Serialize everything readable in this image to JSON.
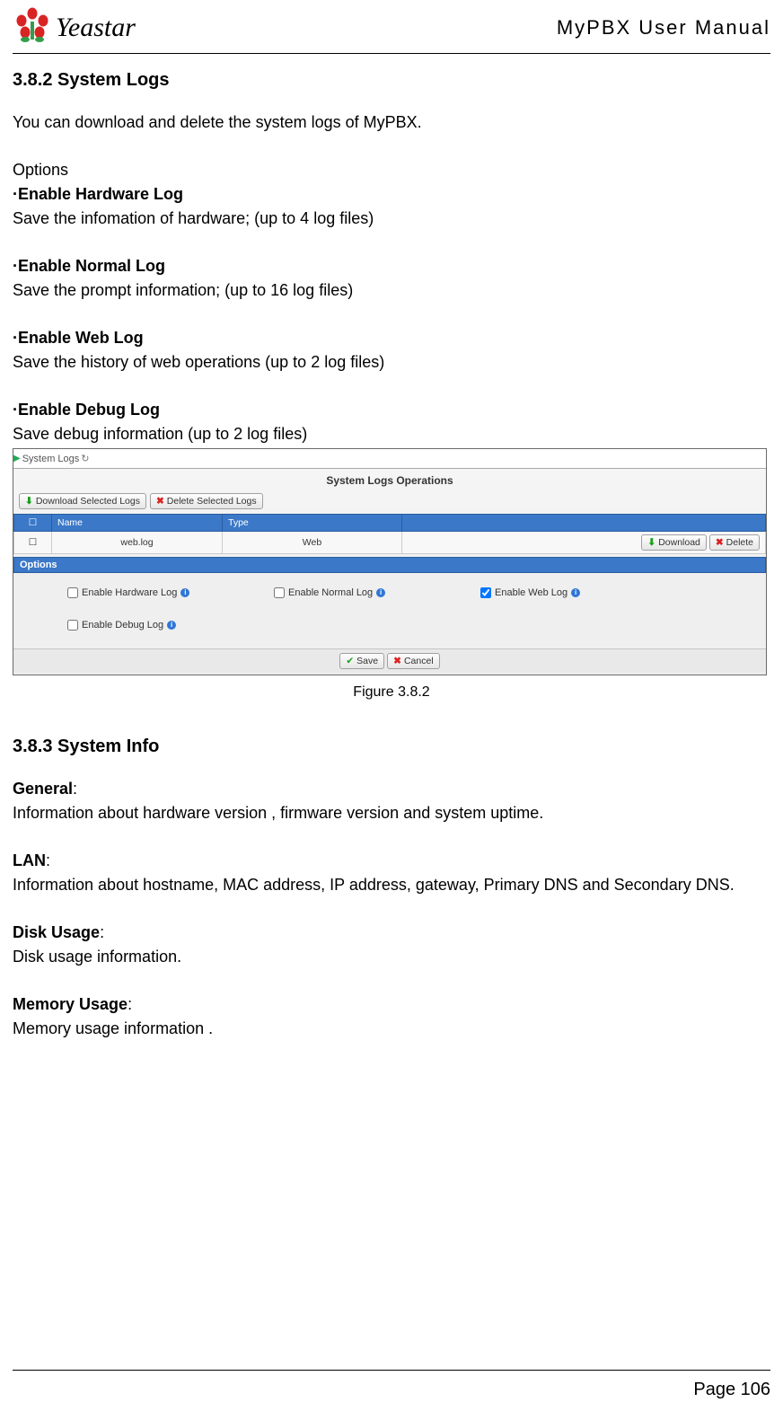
{
  "header": {
    "logo_text": "Yeastar",
    "doc_title": "MyPBX User Manual"
  },
  "s1": {
    "heading": "3.8.2 System Logs",
    "intro": "You can download and delete the system logs of MyPBX.",
    "options_label": "Options",
    "opt1_title": "·Enable Hardware Log",
    "opt1_desc": "Save the infomation of hardware; (up to 4 log files)",
    "opt2_title": "·Enable Normal Log",
    "opt2_desc": "Save the prompt information; (up to 16 log files)",
    "opt3_title": "·Enable Web Log",
    "opt3_desc": "Save the history of web operations (up to 2 log files)",
    "opt4_title": "·Enable Debug Log",
    "opt4_desc": "Save debug information (up to 2 log files)"
  },
  "screenshot": {
    "breadcrumb_label": "System Logs",
    "breadcrumb_refresh": "↻",
    "panel_title": "System Logs Operations",
    "btn_download_selected": "Download Selected Logs",
    "btn_delete_selected": "Delete Selected Logs",
    "table": {
      "col_check": "☐",
      "col_name": "Name",
      "col_type": "Type",
      "col_actions": "",
      "row1": {
        "checked": "☐",
        "name": "web.log",
        "type": "Web",
        "btn_dl": "Download",
        "btn_del": "Delete"
      }
    },
    "options_header": "Options",
    "options": {
      "hw": "Enable Hardware Log",
      "normal": "Enable Normal Log",
      "web": "Enable Web Log",
      "debug": "Enable Debug Log"
    },
    "save_btn": "Save",
    "cancel_btn": "Cancel"
  },
  "fig_caption": "Figure 3.8.2",
  "s2": {
    "heading": "3.8.3 System Info",
    "g_label": "General",
    "g_desc": "Information about hardware version , firmware version and system uptime.",
    "lan_label": "LAN",
    "lan_desc": "Information about hostname, MAC address, IP address, gateway, Primary DNS and Secondary DNS.",
    "disk_label": "Disk Usage",
    "disk_desc": "Disk usage information.",
    "mem_label": "Memory Usage",
    "mem_desc": "Memory usage information ."
  },
  "footer": {
    "page": "Page 106"
  }
}
